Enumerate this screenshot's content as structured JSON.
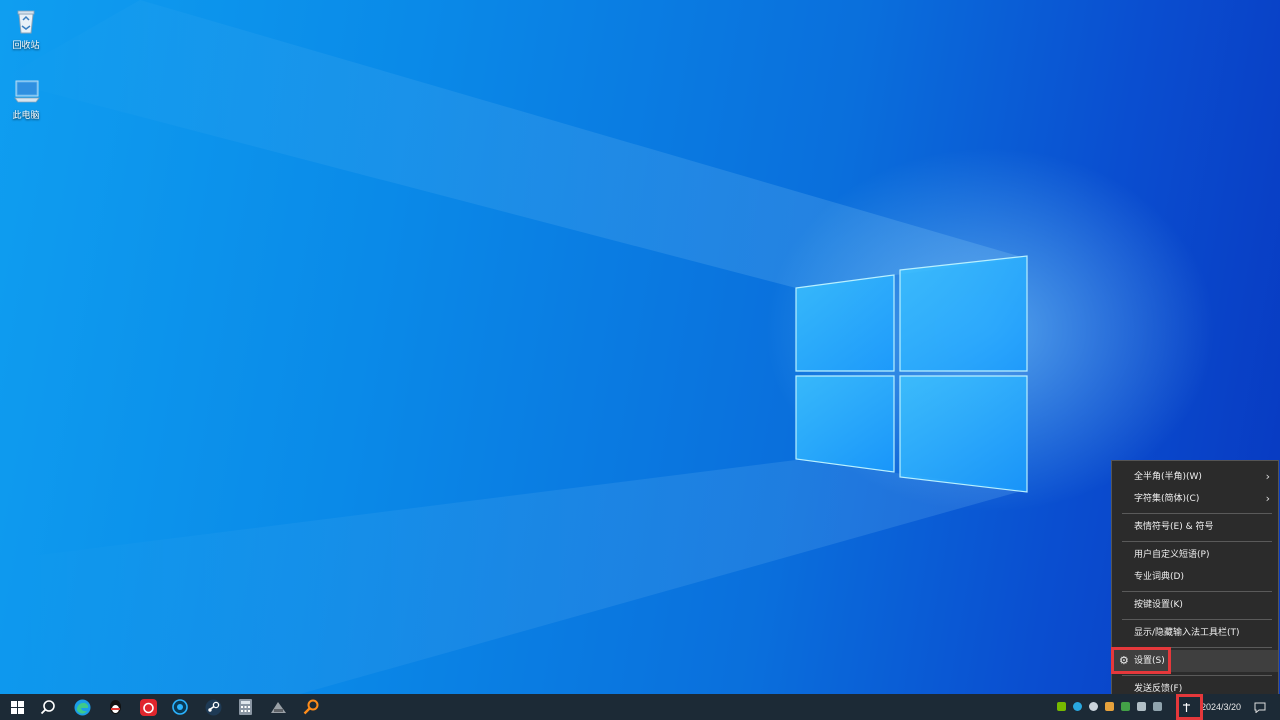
{
  "desktop": {
    "icons": [
      {
        "label": "回收站",
        "icon": "recycle-bin-icon"
      },
      {
        "label": "此电脑",
        "icon": "this-pc-icon"
      }
    ]
  },
  "context_menu": {
    "items": [
      {
        "label": "全半角(半角)(W)",
        "submenu": true
      },
      {
        "label": "字符集(简体)(C)",
        "submenu": true
      },
      {
        "label": "表情符号(E) & 符号",
        "submenu": false
      },
      {
        "label": "用户自定义短语(P)",
        "submenu": false
      },
      {
        "label": "专业词典(D)",
        "submenu": false
      },
      {
        "label": "按键设置(K)",
        "submenu": false
      },
      {
        "label": "显示/隐藏输入法工具栏(T)",
        "submenu": false
      },
      {
        "label": "设置(S)",
        "submenu": false,
        "highlighted": true,
        "icon": "gear-icon"
      },
      {
        "label": "发送反馈(F)",
        "submenu": false
      }
    ],
    "submenu_glyph": "›"
  },
  "taskbar": {
    "pinned": [
      "start-icon",
      "search-icon",
      "edge-icon",
      "qq-icon",
      "netease-music-icon",
      "app-circle-icon",
      "steam-icon",
      "calculator-icon",
      "ink-app-icon",
      "search-tool-icon"
    ],
    "date": "2024/3/20"
  },
  "colors": {
    "highlight_box": "#e5383b",
    "menu_bg": "#2b2b2b",
    "taskbar_bg": "#1c2a36"
  }
}
